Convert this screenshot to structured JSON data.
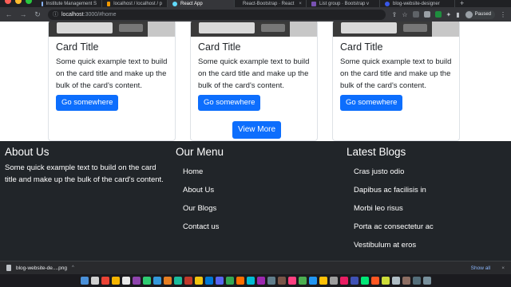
{
  "browser": {
    "tabs": [
      {
        "label": "Institute Management S",
        "active": false
      },
      {
        "label": "localhost / localhost / p",
        "active": false
      },
      {
        "label": "React App",
        "active": true
      },
      {
        "label": "React-Bootstrap · React",
        "active": false
      },
      {
        "label": "List group · Bootstrap v",
        "active": false
      },
      {
        "label": "blog-website-designer",
        "active": false
      }
    ],
    "url_host": "localhost",
    "url_path": ":3000/#home",
    "profile_status": "Paused",
    "traffic_colors": [
      "#ff5f57",
      "#febc2e",
      "#28c840"
    ]
  },
  "cards": [
    {
      "title": "Card Title",
      "text": "Some quick example text to build on the card title and make up the bulk of the card's content.",
      "button": "Go somewhere"
    },
    {
      "title": "Card Title",
      "text": "Some quick example text to build on the card title and make up the bulk of the card's content.",
      "button": "Go somewhere"
    },
    {
      "title": "Card Title",
      "text": "Some quick example text to build on the card title and make up the bulk of the card's content.",
      "button": "Go somewhere"
    }
  ],
  "view_more": "View More",
  "footer": {
    "about": {
      "heading": "About Us",
      "text": "Some quick example text to build on the card title and make up the bulk of the card's content."
    },
    "menu": {
      "heading": "Our Menu",
      "items": [
        "Home",
        "About Us",
        "Our Blogs",
        "Contact us"
      ]
    },
    "blogs": {
      "heading": "Latest Blogs",
      "items": [
        "Cras justo odio",
        "Dapibus ac facilisis in",
        "Morbi leo risus",
        "Porta ac consectetur ac",
        "Vestibulum at eros"
      ]
    }
  },
  "downloads": {
    "file": "blog-website-de....png",
    "show_all": "Show all"
  },
  "colors": {
    "primary": "#0d6efd",
    "footer_bg": "#212529"
  }
}
